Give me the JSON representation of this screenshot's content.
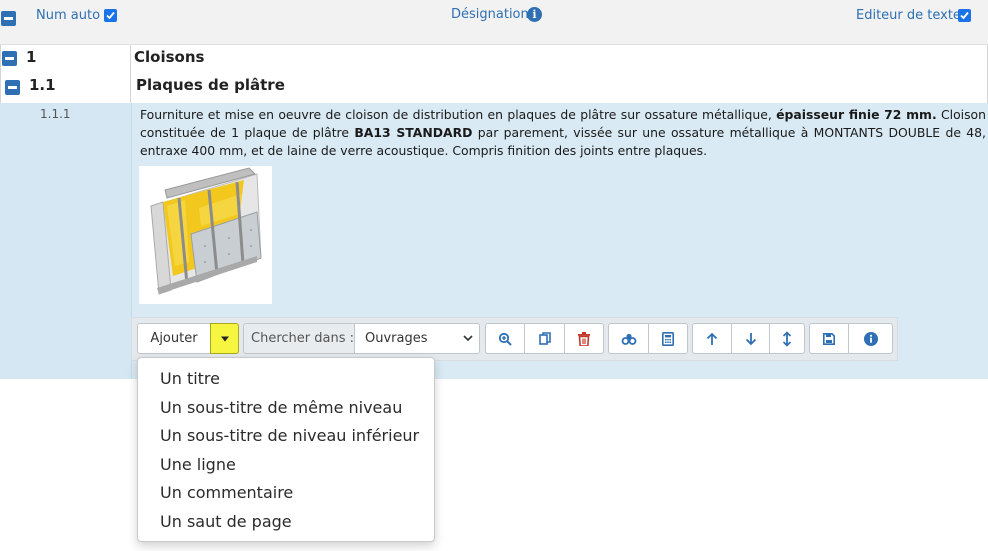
{
  "header": {
    "num_auto_label": "Num auto",
    "num_auto_checked": true,
    "designation_label": "Désignation",
    "editor_label": "Editeur de texte",
    "editor_checked": true
  },
  "rows": [
    {
      "number": "1",
      "title": "Cloisons"
    },
    {
      "number": "1.1",
      "title": "Plaques de plâtre"
    }
  ],
  "item": {
    "number": "1.1.1",
    "desc_1": "Fourniture et mise en oeuvre de cloison de distribution en plaques de plâtre sur ossature métallique, ",
    "desc_bold_1": "épaisseur finie 72 mm.",
    "desc_2": " Cloison constituée de 1 plaque de plâtre ",
    "desc_bold_2": "BA13 STANDARD",
    "desc_3": " par parement, vissée sur une ossature métallique à MONTANTS DOUBLE de 48, entraxe 400 mm, et de laine de verre acoustique. Compris finition des joints entre plaques.",
    "image_icon": "plasterboard-wall-image"
  },
  "toolbar": {
    "add_label": "Ajouter",
    "search_label": "Chercher dans :",
    "search_select_value": "Ouvrages",
    "icons": [
      "zoom-in-icon",
      "copy-icon",
      "trash-icon",
      "link-icon",
      "calculator-icon",
      "arrow-up-icon",
      "arrow-down-icon",
      "arrows-vertical-icon",
      "save-icon",
      "info-icon"
    ]
  },
  "dropdown": {
    "items": [
      "Un titre",
      "Un sous-titre de même niveau",
      "Un sous-titre de niveau inférieur",
      "Une ligne",
      "Un commentaire",
      "Un saut de page"
    ]
  },
  "colors": {
    "accent": "#2f6fb3",
    "row_highlight": "#d9eaf4",
    "caret_button": "#f6f640",
    "delete_icon": "#c0392b"
  }
}
